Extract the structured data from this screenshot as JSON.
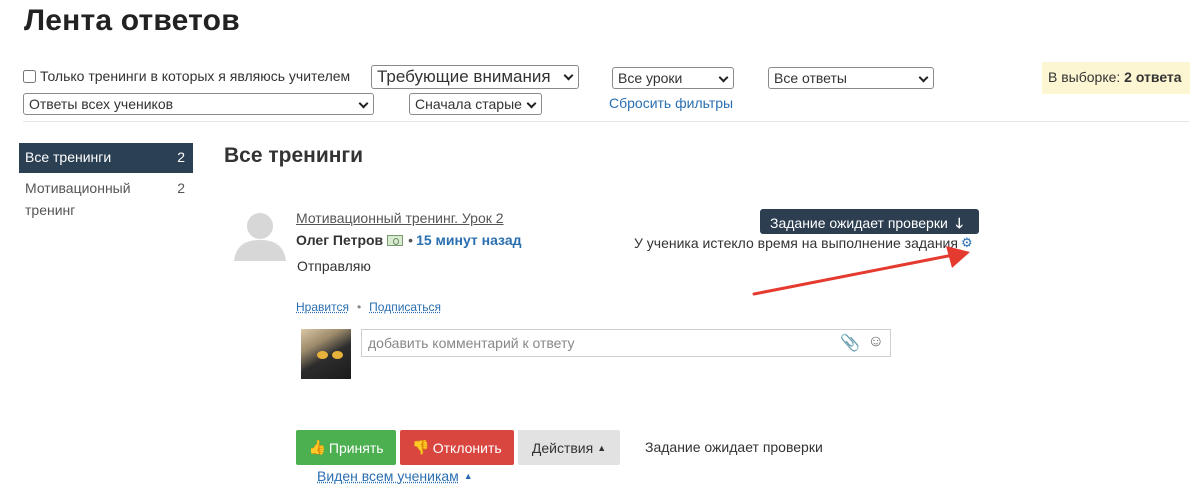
{
  "header": {
    "title": "Лента ответов"
  },
  "filters": {
    "teacher_only_label": "Только тренинги в которых я являюсь учителем",
    "teacher_only_checked": false,
    "attention_select": "Требующие внимания",
    "lessons_select": "Все уроки",
    "answers_select": "Все ответы",
    "students_select": "Ответы всех учеников",
    "sort_select": "Сначала старые",
    "reset_link": "Сбросить фильтры"
  },
  "selection": {
    "label": "В выборке:",
    "count": "2 ответа"
  },
  "sidebar": {
    "items": [
      {
        "label": "Все тренинги",
        "count": "2",
        "active": true
      },
      {
        "label": "Мотивационный тренинг",
        "count": "2",
        "active": false
      }
    ]
  },
  "main": {
    "section_title": "Все тренинги",
    "answer": {
      "lesson_link": "Мотивационный тренинг. Урок 2",
      "author_name": "Олег Петров",
      "separator": "•",
      "time_ago": "15 минут назад",
      "text": "Отправляю",
      "status_badge": "Задание ожидает проверки",
      "expired_note": "У ученика истекло время на выполнение задания",
      "like_link": "Нравится",
      "subscribe_link": "Подписаться",
      "links_separator": "•",
      "comment_placeholder": "добавить комментарий к ответу",
      "accept_button": "Принять",
      "reject_button": "Отклонить",
      "actions_button": "Действия",
      "pending_status": "Задание ожидает проверки",
      "visibility_link": "Виден всем ученикам"
    }
  },
  "colors": {
    "accent": "#2a6fb1",
    "dark_badge": "#2c3e50",
    "accept": "#4caf50",
    "reject": "#d9453f",
    "highlight": "#fdf6d2",
    "annotation_arrow": "#e53a2f"
  },
  "icons": [
    "avatar-placeholder-icon",
    "money-icon",
    "arrow-down-icon",
    "gear-icon",
    "paperclip-icon",
    "smiley-icon",
    "thumbs-up-icon",
    "thumbs-down-icon",
    "caret-up-icon",
    "red-annotation-arrow"
  ]
}
